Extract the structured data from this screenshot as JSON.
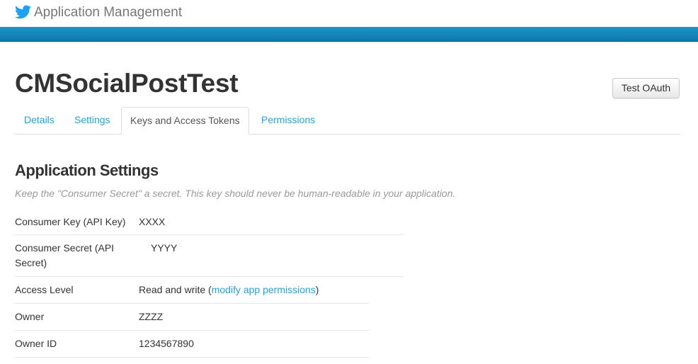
{
  "header": {
    "app_title": "Application Management"
  },
  "page": {
    "title": "CMSocialPostTest",
    "test_oauth_label": "Test OAuth"
  },
  "tabs": [
    {
      "label": "Details"
    },
    {
      "label": "Settings"
    },
    {
      "label": "Keys and Access Tokens",
      "active": true
    },
    {
      "label": "Permissions"
    }
  ],
  "settings": {
    "title": "Application Settings",
    "note": "Keep the \"Consumer Secret\" a secret. This key should never be human-readable in your application.",
    "rows": [
      {
        "label": "Consumer Key (API Key)",
        "value": "XXXX"
      },
      {
        "label_line1": "Consumer Secret (API",
        "label_line2": "Secret)",
        "value": "YYYY"
      },
      {
        "label": "Access Level",
        "value_prefix": "Read and write (",
        "value_link": "modify app permissions",
        "value_suffix": ")"
      },
      {
        "label": "Owner",
        "value": "ZZZZ"
      },
      {
        "label": "Owner ID",
        "value": "1234567890"
      }
    ]
  },
  "colors": {
    "accent_blue": "#2b9fd4",
    "header_bar": "#1b95c9",
    "text": "#333333",
    "muted": "#999999"
  },
  "icons": {
    "logo": "twitter-bird-icon"
  }
}
